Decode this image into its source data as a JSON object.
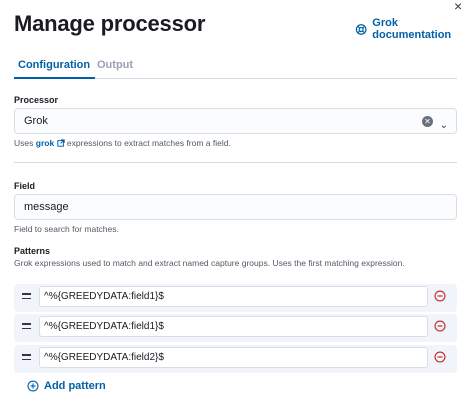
{
  "header": {
    "close_glyph": "×",
    "title": "Manage processor",
    "doc_link": "Grok documentation"
  },
  "tabs": [
    {
      "label": "Configuration",
      "active": true
    },
    {
      "label": "Output",
      "active": false
    }
  ],
  "processor": {
    "label": "Processor",
    "value": "Grok",
    "help_prefix": "Uses",
    "help_link": "grok",
    "help_suffix": "expressions to extract matches from a field."
  },
  "field": {
    "label": "Field",
    "value": "message",
    "help": "Field to search for matches."
  },
  "patterns": {
    "label": "Patterns",
    "help": "Grok expressions used to match and extract named capture groups. Uses the first matching expression.",
    "rows": [
      {
        "value": "^%{GREEDYDATA:field1}$"
      },
      {
        "value": "^%{GREEDYDATA:field1}$"
      },
      {
        "value": "^%{GREEDYDATA:field2}$"
      }
    ],
    "add_label": "Add pattern"
  },
  "colors": {
    "accent": "#0061a6",
    "danger": "#bd271e"
  }
}
